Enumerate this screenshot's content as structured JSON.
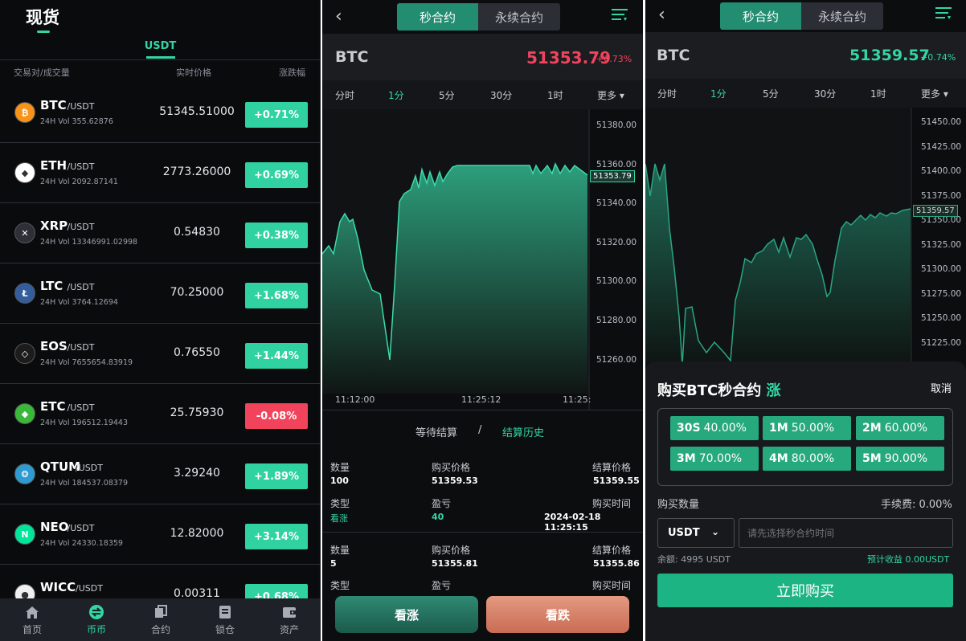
{
  "market": {
    "title": "现货",
    "tab": "USDT",
    "headers": [
      "交易对/成交量",
      "实时价格",
      "涨跌幅"
    ],
    "rows": [
      {
        "symbol": "BTC",
        "quote": "/USDT",
        "vol": "24H Vol 355.62876",
        "price": "51345.51000",
        "change": "+0.71%",
        "up": true,
        "icon_color": "#f7931a",
        "icon": "bitcoin-icon",
        "glyph": "₿"
      },
      {
        "symbol": "ETH",
        "quote": "/USDT",
        "vol": "24H Vol 2092.87141",
        "price": "2773.26000",
        "change": "+0.69%",
        "up": true,
        "icon_color": "#ffffff",
        "icon": "ethereum-icon",
        "glyph": "◆"
      },
      {
        "symbol": "XRP",
        "quote": "/USDT",
        "vol": "24H Vol 13346991.02998",
        "price": "0.54830",
        "change": "+0.38%",
        "up": true,
        "icon_color": "#2d3036",
        "icon": "xrp-icon",
        "glyph": "✕"
      },
      {
        "symbol": "LTC",
        "quote": "/USDT",
        "vol": "24H Vol 3764.12694",
        "price": "70.25000",
        "change": "+1.68%",
        "up": true,
        "icon_color": "#345d9d",
        "icon": "litecoin-icon",
        "glyph": "Ł"
      },
      {
        "symbol": "EOS",
        "quote": "/USDT",
        "vol": "24H Vol 7655654.83919",
        "price": "0.76550",
        "change": "+1.44%",
        "up": true,
        "icon_color": "#1c1c1c",
        "icon": "eos-icon",
        "glyph": "◇"
      },
      {
        "symbol": "ETC",
        "quote": "/USDT",
        "vol": "24H Vol 196512.19443",
        "price": "25.75930",
        "change": "-0.08%",
        "up": false,
        "icon_color": "#3ab83a",
        "icon": "ethereum-classic-icon",
        "glyph": "◆"
      },
      {
        "symbol": "QTUM",
        "quote": "/USDT",
        "vol": "24H Vol 184537.08379",
        "price": "3.29240",
        "change": "+1.89%",
        "up": true,
        "icon_color": "#2e9ad0",
        "icon": "qtum-icon",
        "glyph": "❂"
      },
      {
        "symbol": "NEO",
        "quote": "/USDT",
        "vol": "24H Vol 24330.18359",
        "price": "12.82000",
        "change": "+3.14%",
        "up": true,
        "icon_color": "#00e599",
        "icon": "neo-icon",
        "glyph": "N"
      },
      {
        "symbol": "WICC",
        "quote": "/USDT",
        "vol": "",
        "price": "0.00311",
        "change": "+0.68%",
        "up": true,
        "icon_color": "#f0f0f0",
        "icon": "wicc-icon",
        "glyph": "●"
      }
    ],
    "nav": [
      {
        "label": "首页",
        "icon": "home-icon",
        "active": false
      },
      {
        "label": "币币",
        "icon": "swap-icon",
        "active": true
      },
      {
        "label": "合约",
        "icon": "contract-icon",
        "active": false
      },
      {
        "label": "锁仓",
        "icon": "lock-icon",
        "active": false
      },
      {
        "label": "资产",
        "icon": "wallet-icon",
        "active": false
      }
    ]
  },
  "contract": {
    "seg_on": "秒合约",
    "seg_off": "永续合约",
    "pair": "BTC",
    "price": "51353.79",
    "change": "+0.73%",
    "intervals": [
      "分时",
      "1分",
      "5分",
      "30分",
      "1时",
      "更多"
    ],
    "active_interval": "1分",
    "y_ticks": [
      "51380.00",
      "51360.00",
      "51340.00",
      "51320.00",
      "51300.00",
      "51280.00",
      "51260.00"
    ],
    "current_badge": "51353.79",
    "x_ticks": [
      "11:12:00",
      "11:25:12",
      "11:25:"
    ],
    "history_tabs": {
      "pending": "等待结算",
      "sep": "/",
      "history": "结算历史"
    },
    "orders": [
      {
        "qty_label": "数量",
        "qty": "100",
        "buy_label": "购买价格",
        "buy": "51359.53",
        "settle_label": "结算价格",
        "settle": "51359.55",
        "type_label": "类型",
        "type": "看涨",
        "pnl_label": "盈亏",
        "pnl": "40",
        "time_label": "购买时间",
        "time": "2024-02-18 11:25:15"
      },
      {
        "qty_label": "数量",
        "qty": "5",
        "buy_label": "购买价格",
        "buy": "51355.81",
        "settle_label": "结算价格",
        "settle": "51355.86",
        "type_label": "类型",
        "type": "",
        "pnl_label": "盈亏",
        "pnl": "",
        "time_label": "购买时间",
        "time": ""
      }
    ],
    "btn_up": "看涨",
    "btn_down": "看跌",
    "up_color": "#33d6a3",
    "down_color": "#f2435c"
  },
  "purchase": {
    "seg_on": "秒合约",
    "seg_off": "永续合约",
    "pair": "BTC",
    "price": "51359.57",
    "change": "+0.74%",
    "intervals": [
      "分时",
      "1分",
      "5分",
      "30分",
      "1时",
      "更多"
    ],
    "y_ticks": [
      "51450.00",
      "51425.00",
      "51400.00",
      "51375.00",
      "51350.00",
      "51325.00",
      "51300.00",
      "51275.00",
      "51250.00",
      "51225.00"
    ],
    "current_badge": "51359.57",
    "modal": {
      "title": "购买BTC秒合约",
      "direction": "涨",
      "cancel": "取消",
      "options": [
        {
          "period": "30S",
          "rate": "40.00%"
        },
        {
          "period": "1M",
          "rate": "50.00%"
        },
        {
          "period": "2M",
          "rate": "60.00%"
        },
        {
          "period": "3M",
          "rate": "70.00%"
        },
        {
          "period": "4M",
          "rate": "80.00%"
        },
        {
          "period": "5M",
          "rate": "90.00%"
        }
      ],
      "qty_label": "购买数量",
      "fee": "手续费: 0.00%",
      "currency": "USDT",
      "amount_placeholder": "请先选择秒合约时间",
      "balance": "余额: 4995 USDT",
      "expected": "预计收益 0.00USDT",
      "buy": "立即购买"
    }
  }
}
